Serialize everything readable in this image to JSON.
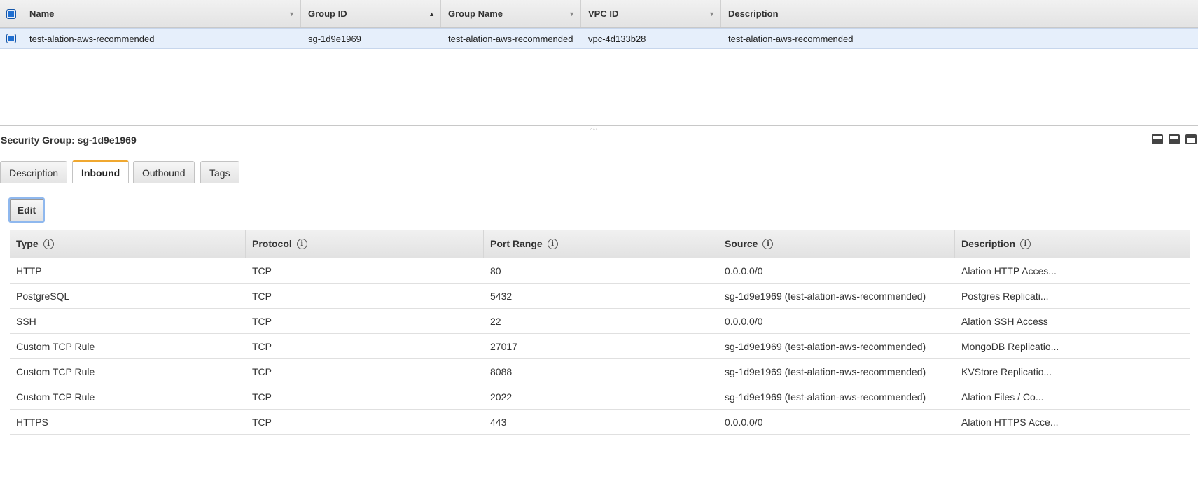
{
  "top_grid": {
    "columns": [
      {
        "label": "Name",
        "sort": "▼"
      },
      {
        "label": "Group ID",
        "sort": "▲"
      },
      {
        "label": "Group Name",
        "sort": "▼"
      },
      {
        "label": "VPC ID",
        "sort": "▼"
      },
      {
        "label": "Description",
        "sort": ""
      }
    ],
    "rows": [
      {
        "name": "test-alation-aws-recommended",
        "group_id": "sg-1d9e1969",
        "group_name": "test-alation-aws-recommended",
        "vpc_id": "vpc-4d133b28",
        "description": "test-alation-aws-recommended"
      }
    ]
  },
  "splitter": {
    "grip": "◦◦◦"
  },
  "detail": {
    "title": "Security Group: sg-1d9e1969",
    "tabs": [
      {
        "label": "Description",
        "active": false
      },
      {
        "label": "Inbound",
        "active": true
      },
      {
        "label": "Outbound",
        "active": false
      },
      {
        "label": "Tags",
        "active": false
      }
    ],
    "edit_label": "Edit"
  },
  "rules": {
    "info_glyph": "i",
    "columns": [
      "Type",
      "Protocol",
      "Port Range",
      "Source",
      "Description"
    ],
    "rows": [
      {
        "type": "HTTP",
        "protocol": "TCP",
        "port": "80",
        "source": "0.0.0.0/0",
        "description": "Alation HTTP Acces..."
      },
      {
        "type": "PostgreSQL",
        "protocol": "TCP",
        "port": "5432",
        "source": "sg-1d9e1969 (test-alation-aws-recommended)",
        "description": "Postgres Replicati..."
      },
      {
        "type": "SSH",
        "protocol": "TCP",
        "port": "22",
        "source": "0.0.0.0/0",
        "description": "Alation SSH Access"
      },
      {
        "type": "Custom TCP Rule",
        "protocol": "TCP",
        "port": "27017",
        "source": "sg-1d9e1969 (test-alation-aws-recommended)",
        "description": "MongoDB Replicatio..."
      },
      {
        "type": "Custom TCP Rule",
        "protocol": "TCP",
        "port": "8088",
        "source": "sg-1d9e1969 (test-alation-aws-recommended)",
        "description": "KVStore Replicatio..."
      },
      {
        "type": "Custom TCP Rule",
        "protocol": "TCP",
        "port": "2022",
        "source": "sg-1d9e1969 (test-alation-aws-recommended)",
        "description": "Alation Files / Co..."
      },
      {
        "type": "HTTPS",
        "protocol": "TCP",
        "port": "443",
        "source": "0.0.0.0/0",
        "description": "Alation HTTPS Acce..."
      }
    ]
  },
  "colors": {
    "accent": "#1f6fd1",
    "active_tab": "#f0a830",
    "selected_row": "#e6effb"
  }
}
